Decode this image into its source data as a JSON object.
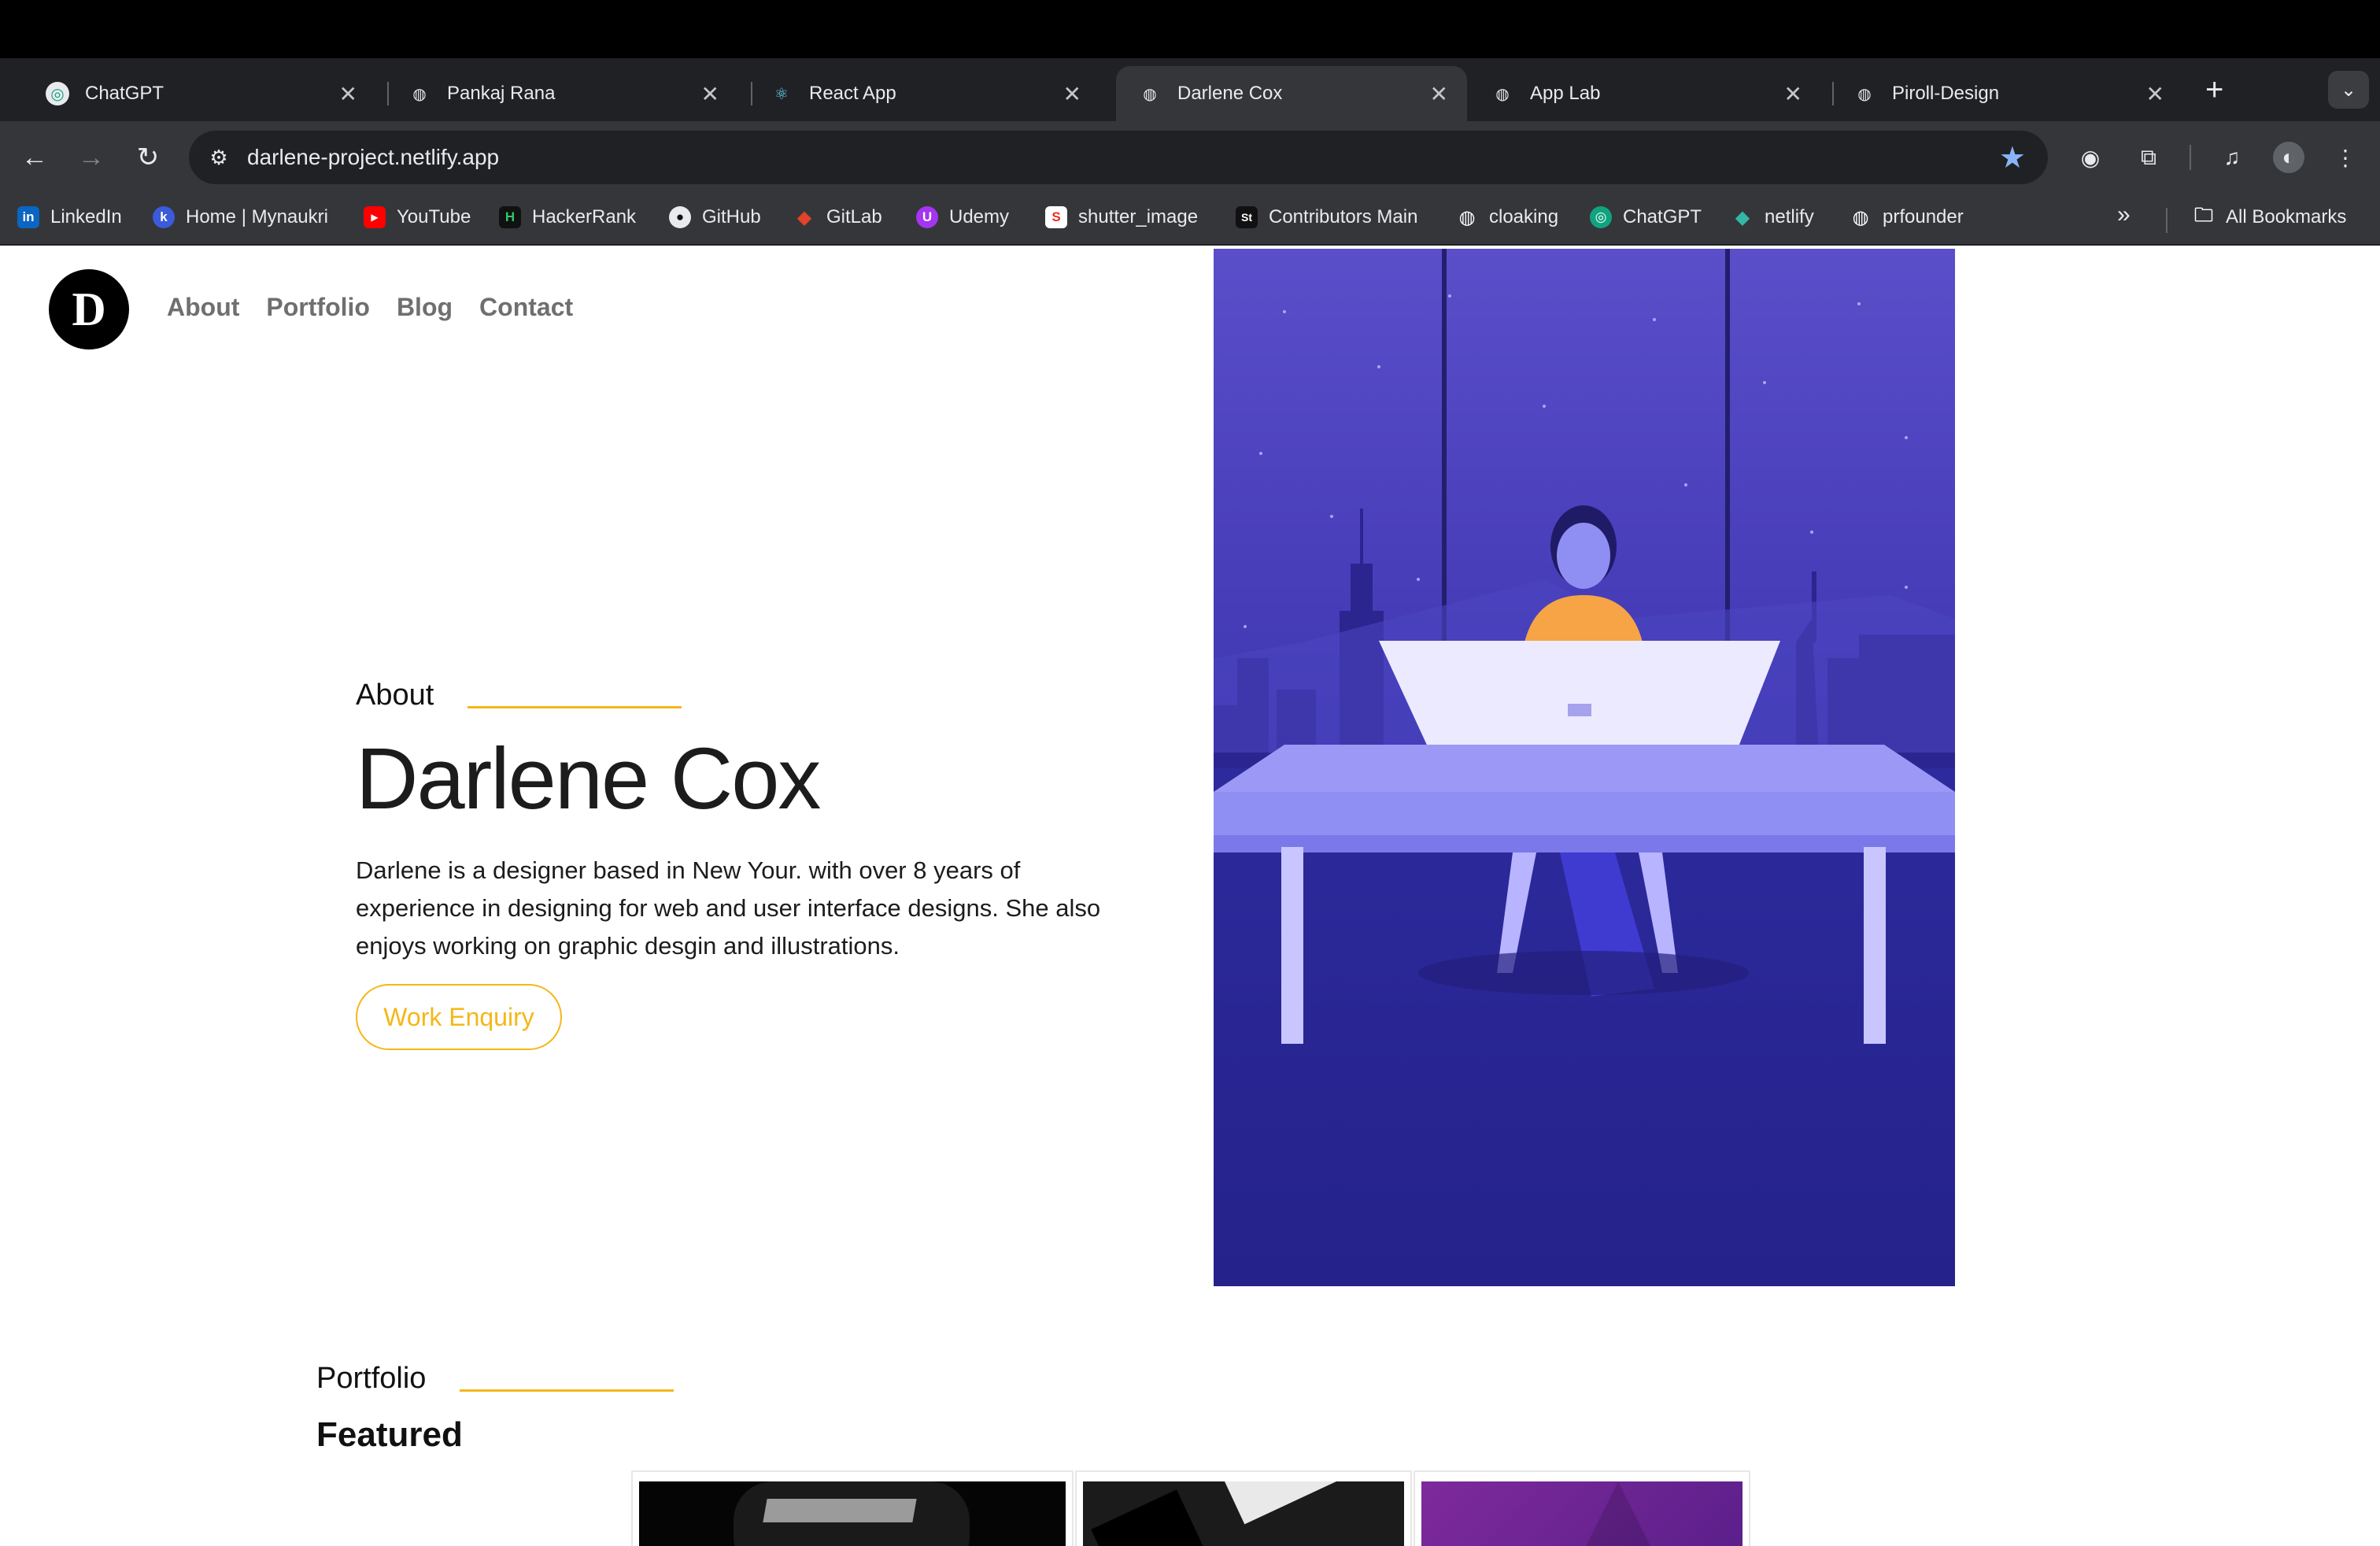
{
  "browser": {
    "tabs": [
      {
        "label": "ChatGPT",
        "icon": "chatgpt-icon",
        "active": false
      },
      {
        "label": "Pankaj Rana",
        "icon": "globe-icon",
        "active": false
      },
      {
        "label": "React App",
        "icon": "react-icon",
        "active": false
      },
      {
        "label": "Darlene Cox",
        "icon": "globe-icon",
        "active": true
      },
      {
        "label": "App Lab",
        "icon": "globe-icon",
        "active": false
      },
      {
        "label": "Piroll-Design",
        "icon": "globe-icon",
        "active": false
      }
    ],
    "tab_close_glyph": "✕",
    "new_tab_glyph": "+",
    "url": "darlene-project.netlify.app",
    "bookmarks": [
      {
        "label": "LinkedIn",
        "icon": "linkedin-icon",
        "color": "#0a66c2",
        "glyph": "in"
      },
      {
        "label": "Home | Mynaukri",
        "icon": "mynaukri-icon",
        "color": "#3b5bdb",
        "glyph": "k"
      },
      {
        "label": "YouTube",
        "icon": "youtube-icon",
        "color": "#ff0000",
        "glyph": "▶"
      },
      {
        "label": "HackerRank",
        "icon": "hackerrank-icon",
        "color": "#111111",
        "glyph": "H"
      },
      {
        "label": "GitHub",
        "icon": "github-icon",
        "color": "#35363a",
        "glyph": "●"
      },
      {
        "label": "GitLab",
        "icon": "gitlab-icon",
        "color": "#e24329",
        "glyph": "◆"
      },
      {
        "label": "Udemy",
        "icon": "udemy-icon",
        "color": "#a435f0",
        "glyph": "U"
      },
      {
        "label": "shutter_image",
        "icon": "shutterstock-icon",
        "color": "#ee2b24",
        "glyph": "S"
      },
      {
        "label": "Contributors Main",
        "icon": "stock-icon",
        "color": "#111111",
        "glyph": "St"
      },
      {
        "label": "cloaking",
        "icon": "globe-icon",
        "color": "#35363a",
        "glyph": "◍"
      },
      {
        "label": "ChatGPT",
        "icon": "chatgpt-icon",
        "color": "#10a37f",
        "glyph": "◎"
      },
      {
        "label": "netlify",
        "icon": "netlify-icon",
        "color": "#32b8a5",
        "glyph": "◆"
      },
      {
        "label": "prfounder",
        "icon": "globe-icon",
        "color": "#35363a",
        "glyph": "◍"
      }
    ],
    "more_bookmarks_glyph": "»",
    "all_bookmarks_label": "All Bookmarks"
  },
  "site": {
    "logo_letter": "D",
    "nav": [
      "About",
      "Portfolio",
      "Blog",
      "Contact"
    ],
    "hero": {
      "section_label": "About",
      "name": "Darlene Cox",
      "description": "Darlene is a designer based in New Your. with over 8 years of experience in designing for web and user interface designs. She also enjoys working on graphic desgin and illustrations.",
      "button_label": "Work Enquiry"
    },
    "portfolio": {
      "section_label": "Portfolio",
      "heading": "Featured"
    }
  },
  "colors": {
    "accent": "#f5b718",
    "illustration_bg": "#3a34a8"
  }
}
